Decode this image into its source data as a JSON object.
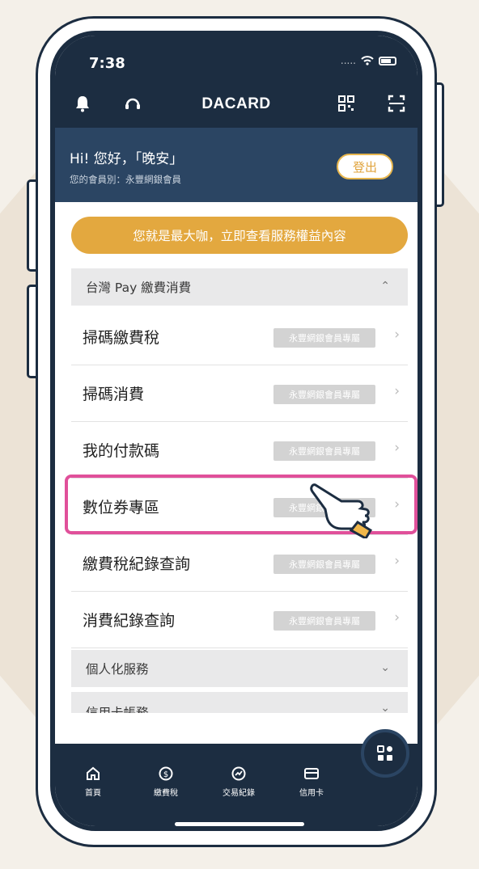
{
  "status": {
    "time": "7:38",
    "signal": "....."
  },
  "header": {
    "brand": "DACARD"
  },
  "greeting": {
    "title": "Hi! 您好，「晚安」",
    "subtitle": "您的會員別：永豐網銀會員",
    "logout_label": "登出"
  },
  "promo": {
    "label": "您就是最大咖，立即查看服務權益內容"
  },
  "sections": [
    {
      "title": "台灣 Pay 繳費消費",
      "state": "expanded"
    },
    {
      "title": "個人化服務",
      "state": "collapsed"
    },
    {
      "title": "信用卡帳務",
      "state": "collapsed"
    }
  ],
  "menu_items": [
    {
      "label": "掃碼繳費稅",
      "tag": "永豐網銀會員專屬"
    },
    {
      "label": "掃碼消費",
      "tag": "永豐網銀會員專屬"
    },
    {
      "label": "我的付款碼",
      "tag": "永豐網銀會員專屬"
    },
    {
      "label": "數位券專區",
      "tag": "永豐網銀會員專屬",
      "highlighted": true
    },
    {
      "label": "繳費稅紀錄查詢",
      "tag": "永豐網銀會員專屬"
    },
    {
      "label": "消費紀錄查詢",
      "tag": "永豐網銀會員專屬"
    }
  ],
  "tabbar": {
    "tabs": [
      {
        "label": "首頁",
        "icon": "home-icon"
      },
      {
        "label": "繳費稅",
        "icon": "dollar-icon"
      },
      {
        "label": "交易紀錄",
        "icon": "chart-icon"
      },
      {
        "label": "信用卡",
        "icon": "card-icon"
      }
    ],
    "fab_icon": "grid-icon"
  },
  "colors": {
    "navy": "#1c2d41",
    "navy_light": "#2b4563",
    "gold": "#e3a83f",
    "highlight_pink": "#e0509a"
  }
}
